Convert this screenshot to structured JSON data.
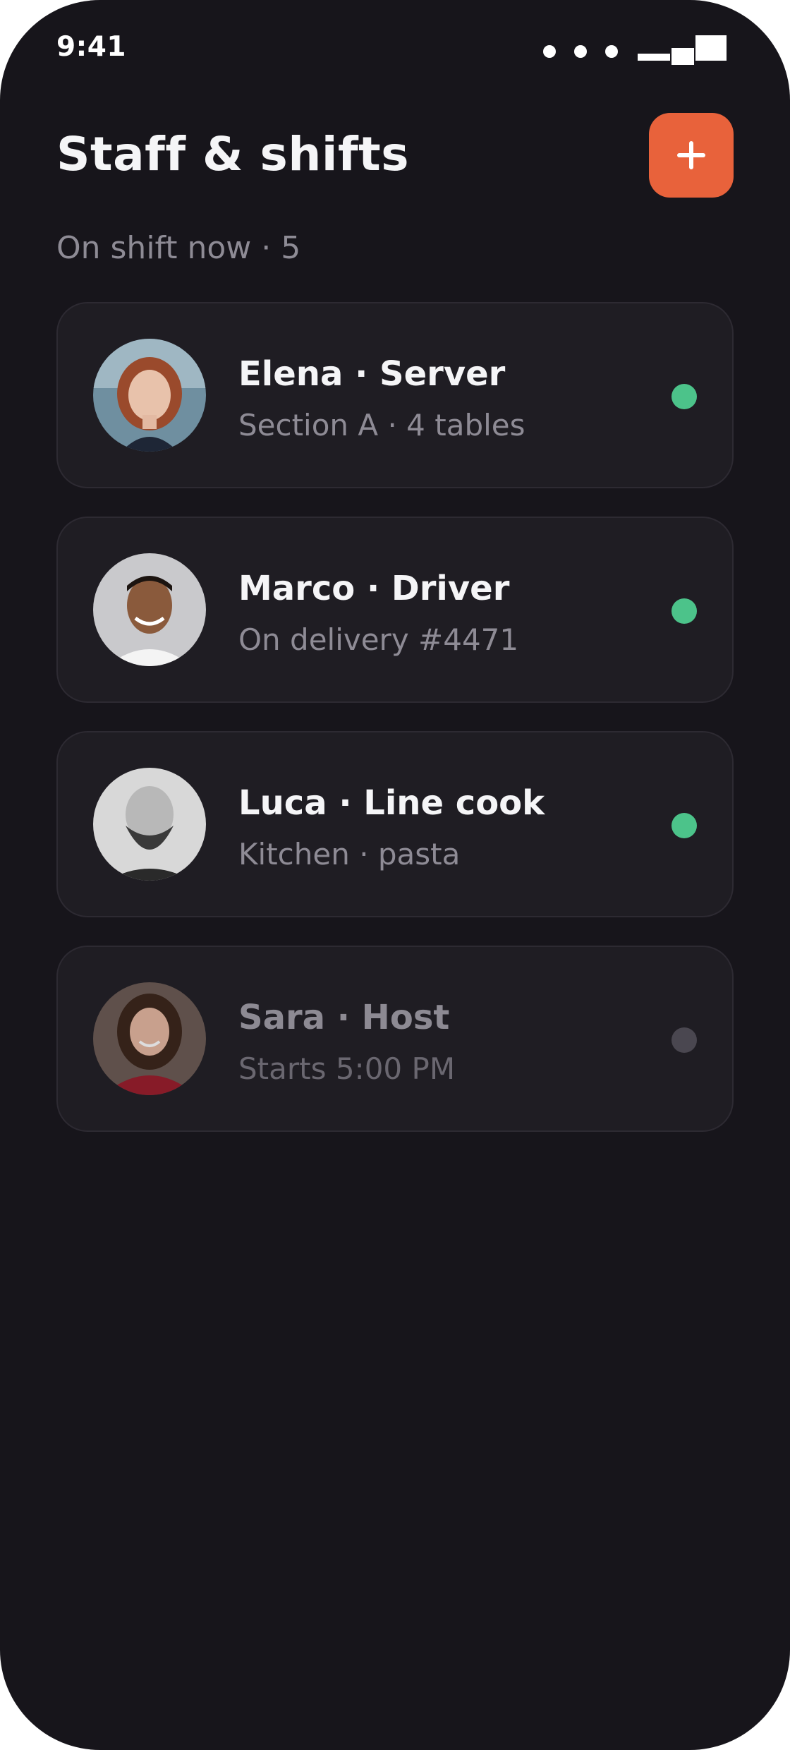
{
  "status_bar": {
    "time": "9:41"
  },
  "header": {
    "title": "Staff & shifts",
    "add_icon": "plus-icon"
  },
  "summary": {
    "text": "On shift now · 5"
  },
  "colors": {
    "accent": "#e8623b",
    "online": "#4cc38a",
    "offline": "#4a4750",
    "background": "#17151b",
    "card": "#1f1d23"
  },
  "staff": [
    {
      "name": "Elena · Server",
      "detail": "Section A · 4 tables",
      "status": "on-shift",
      "status_color": "#4cc38a"
    },
    {
      "name": "Marco · Driver",
      "detail": "On delivery #4471",
      "status": "on-shift",
      "status_color": "#4cc38a"
    },
    {
      "name": "Luca · Line cook",
      "detail": "Kitchen · pasta",
      "status": "on-shift",
      "status_color": "#4cc38a"
    },
    {
      "name": "Sara · Host",
      "detail": "Starts 5:00 PM",
      "status": "off-shift",
      "status_color": "#4a4750"
    }
  ]
}
